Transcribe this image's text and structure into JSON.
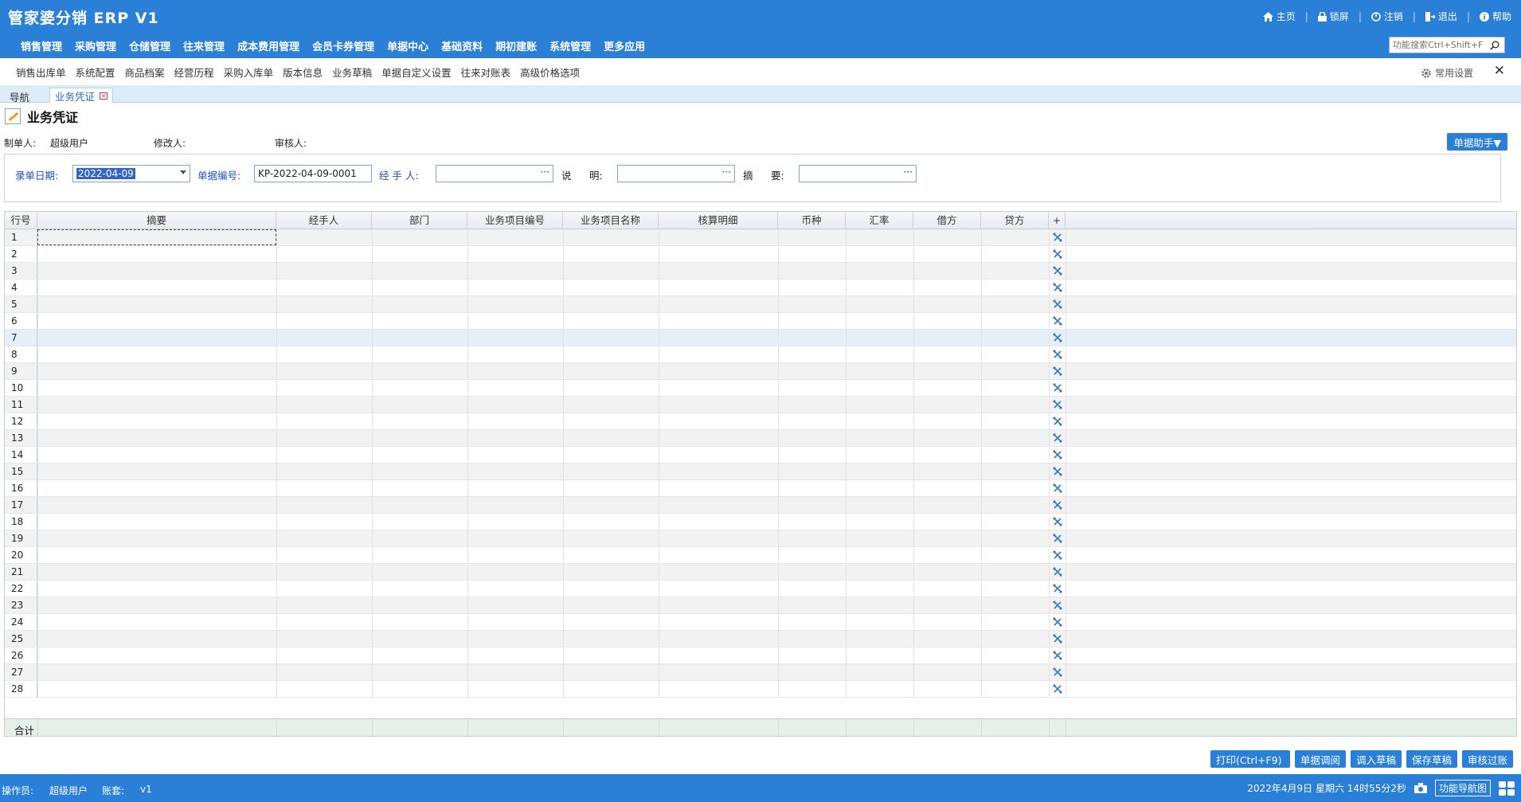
{
  "app": {
    "title": "管家婆分销 ERP V1"
  },
  "top_links": [
    {
      "label": "主页",
      "icon": "home-icon"
    },
    {
      "label": "锁屏",
      "icon": "lock-icon"
    },
    {
      "label": "注销",
      "icon": "power-icon"
    },
    {
      "label": "退出",
      "icon": "exit-icon"
    },
    {
      "label": "帮助",
      "icon": "info-icon"
    }
  ],
  "menu": [
    "销售管理",
    "采购管理",
    "仓储管理",
    "往来管理",
    "成本费用管理",
    "会员卡券管理",
    "单据中心",
    "基础资料",
    "期初建账",
    "系统管理",
    "更多应用"
  ],
  "search": {
    "placeholder": "功能搜索Ctrl+Shift+F"
  },
  "quick_items": [
    "销售出库单",
    "系统配置",
    "商品档案",
    "经营历程",
    "采购入库单",
    "版本信息",
    "业务草稿",
    "单据自定义设置",
    "往来对账表",
    "高级价格选项"
  ],
  "common_settings": "常用设置",
  "tabs": {
    "nav": "导航",
    "voucher": "业务凭证"
  },
  "page": {
    "title": "业务凭证"
  },
  "creators": {
    "maker_label": "制单人:",
    "maker_value": "超级用户",
    "modifier_label": "修改人:",
    "modifier_value": "",
    "auditor_label": "审核人:",
    "auditor_value": ""
  },
  "helper_button": "单据助手▼",
  "form": {
    "date_label": "录单日期:",
    "date_value": "2022-04-09",
    "number_label": "单据编号:",
    "number_value": "KP-2022-04-09-0001",
    "handler_label": "经 手 人:",
    "handler_value": "",
    "desc_label_a": "说",
    "desc_label_b": "明:",
    "desc_value": "",
    "summary_label_a": "摘",
    "summary_label_b": "要:",
    "summary_value": ""
  },
  "grid": {
    "row_header": "行号",
    "columns": [
      "摘要",
      "经手人",
      "部门",
      "业务项目编号",
      "业务项目名称",
      "核算明细",
      "币种",
      "汇率",
      "借方",
      "贷方"
    ],
    "add_symbol": "+",
    "rows": [
      "1",
      "2",
      "3",
      "4",
      "5",
      "6",
      "7",
      "8",
      "9",
      "10",
      "11",
      "12",
      "13",
      "14",
      "15",
      "16",
      "17",
      "18",
      "19",
      "20",
      "21",
      "22",
      "23",
      "24",
      "25",
      "26",
      "27",
      "28"
    ],
    "total_label": "合计"
  },
  "actions": [
    "打印(Ctrl+F9)",
    "单据调阅",
    "调入草稿",
    "保存草稿",
    "审核过账"
  ],
  "status": {
    "operator_label": "操作员:",
    "operator_value": "超级用户",
    "account_label": "账套:",
    "account_value": "v1",
    "datetime": "2022年4月9日  星期六  14时55分2秒",
    "nav_button": "功能导航图"
  }
}
